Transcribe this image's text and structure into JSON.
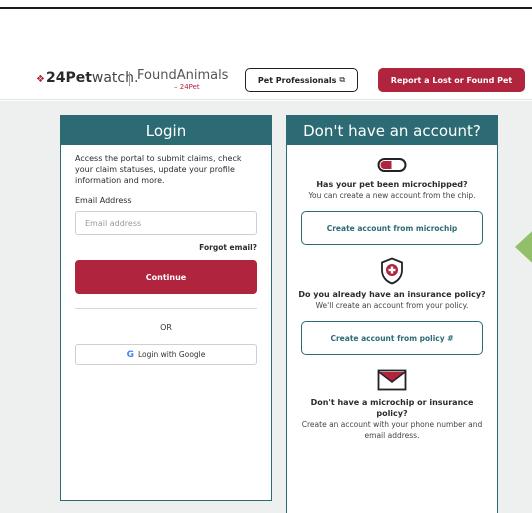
{
  "header": {
    "brand_main_bold": "24Pet",
    "brand_main_light": "watch.",
    "brand_secondary": "FoundAnimals",
    "brand_secondary_sub": "24Pet",
    "pro_button": "Pet Professionals",
    "report_button": "Report a Lost or Found Pet"
  },
  "login": {
    "title": "Login",
    "intro": "Access the portal to submit claims, check your claim statuses, update your profile information and more.",
    "email_label": "Email Address",
    "email_placeholder": "Email address",
    "forgot": "Forgot email?",
    "continue": "Continue",
    "or": "OR",
    "google": "Login with Google"
  },
  "signup": {
    "title": "Don't have an account?",
    "microchip_question": "Has your pet been microchipped?",
    "microchip_desc": "You can create a new account from the chip.",
    "microchip_button": "Create account from microchip",
    "insurance_question": "Do you already have an insurance policy?",
    "insurance_desc": "We'll create an account from your policy.",
    "insurance_button": "Create account from policy #",
    "neither_question": "Don't have a microchip or insurance policy?",
    "neither_desc": "Create an account with your phone number and email address."
  },
  "colors": {
    "teal": "#2c6b73",
    "crimson": "#b0243d",
    "arrow": "#94bf6a"
  }
}
